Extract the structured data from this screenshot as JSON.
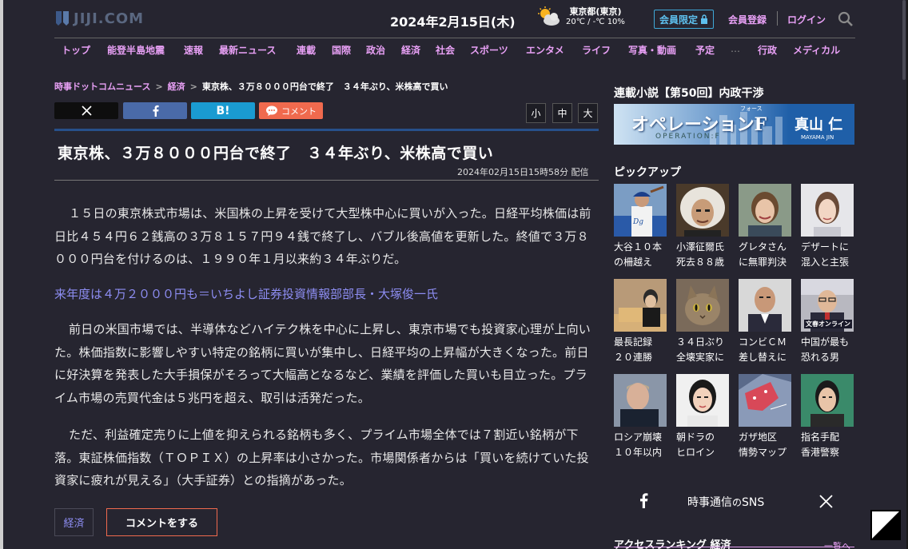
{
  "header": {
    "logo_text": "JIJI.COM",
    "date": "2024年2月15日(木)",
    "weather": {
      "place": "東京都(東京)",
      "temp": "20℃ / -℃ 10%",
      "icon": "partly-cloudy-icon"
    },
    "member_limited": "会員限定",
    "member_register": "会員登録",
    "login": "ログイン"
  },
  "nav": {
    "items": [
      "トップ",
      "能登半島地震",
      "速報",
      "最新ニュース",
      "連載",
      "国際",
      "政治",
      "経済",
      "社会",
      "スポーツ",
      "エンタメ",
      "ライフ",
      "写真・動画",
      "予定"
    ],
    "more": "…",
    "extra": [
      "行政",
      "メディカル"
    ]
  },
  "breadcrumb": {
    "home": "時事ドットコムニュース",
    "category": "経済",
    "current": "東京株、３万８０００円台で終了　３４年ぶり、米株高で買い",
    "separator": ">"
  },
  "share": {
    "x_icon": "x-logo-icon",
    "fb_icon": "facebook-icon",
    "hatena_label": "B!",
    "comment_label": "コメント"
  },
  "font_size": {
    "small": "小",
    "medium": "中",
    "large": "大"
  },
  "article": {
    "title": "東京株、３万８０００円台で終了　３４年ぶり、米株高で買い",
    "published": "2024年02月15日15時58分 配信",
    "paragraphs": [
      "１５日の東京株式市場は、米国株の上昇を受けて大型株中心に買いが入った。日経平均株価は前日比４５４円６２銭高の３万８１５７円９４銭で終了し、バブル後高値を更新した。終値で３万８０００円台を付けるのは、１９９０年１月以来約３４年ぶりだ。",
      "前日の米国市場では、半導体などハイテク株を中心に上昇し、東京市場でも投資家心理が上向いた。株価指数に影響しやすい特定の銘柄に買いが集中し、日経平均の上昇幅が大きくなった。前日に好決算を発表した大手損保がそろって大幅高となるなど、業績を評価した買いも目立った。プライム市場の売買代金は５兆円を超え、取引は活発だった。",
      "ただ、利益確定売りに上値を抑えられる銘柄も多く、プライム市場全体では７割近い銘柄が下落。東証株価指数（ＴＯＰＩＸ）の上昇率は小さかった。市場関係者からは「買いを続けていた投資家に疲れが見える」（大手証券）との指摘があった。"
    ],
    "related_link": "来年度は４万２０００円も＝いちよし証券投資情報部部長・大塚俊一氏",
    "tag": "経済",
    "comment_button": "コメントをする"
  },
  "sidebar": {
    "serial_heading": "連載小説【第50回】内政干渉",
    "banner": {
      "title": "オペレーションF",
      "ruby": "フォース",
      "subtitle": "OPERATION:F",
      "author": "真山 仁",
      "author_en": "MAYAMA JIN"
    },
    "pickup_heading": "ピックアップ",
    "pickups": [
      {
        "caption": "大谷１０本\nの柵越え"
      },
      {
        "caption": "小澤征爾氏\n死去８８歳"
      },
      {
        "caption": "グレタさん\nに無罪判決"
      },
      {
        "caption": "デザートに\n混入と主張"
      },
      {
        "caption": "最長記録\n２０連勝"
      },
      {
        "caption": "３４日ぶり\n全壊実家に"
      },
      {
        "caption": "コンビＣＭ\n差し替えに"
      },
      {
        "caption": "中国が最も\n恐れる男"
      },
      {
        "caption": "ロシア崩壊\n１０年以内"
      },
      {
        "caption": "朝ドラの\nヒロイン"
      },
      {
        "caption": "ガザ地区\n情勢マップ"
      },
      {
        "caption": "指名手配\n香港警察"
      }
    ],
    "pickup_badge": "文春オンライン",
    "sns_label_main": "時事通信",
    "sns_label_small": "の",
    "sns_label_tail": "SNS",
    "ranking_heading": "アクセスランキング 経済",
    "ranking_more": "一覧へ"
  }
}
